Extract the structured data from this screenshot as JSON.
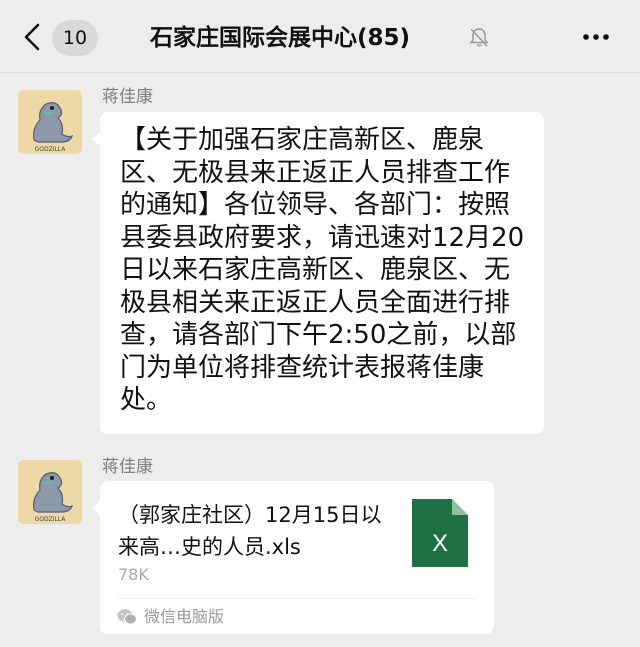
{
  "header": {
    "unread_count": "10",
    "title": "石家庄国际会展中心(85)"
  },
  "messages": [
    {
      "sender": "蒋佳康",
      "avatar_text": "GODZILLA",
      "text": "【关于加强石家庄高新区、鹿泉区、无极县来正返正人员排查工作的通知】各位领导、各部门：按照县委县政府要求，请迅速对12月20日以来石家庄高新区、鹿泉区、无极县相关来正返正人员全面进行排查，请各部门下午2:50之前，以部门为单位将排查统计表报蒋佳康处。"
    },
    {
      "sender": "蒋佳康",
      "avatar_text": "GODZILLA",
      "file": {
        "name": "（郭家庄社区）12月15日以来高…史的人员.xls",
        "size": "78K",
        "icon_letter": "X",
        "source": "微信电脑版"
      }
    }
  ],
  "colors": {
    "background": "#ededed",
    "bubble": "#ffffff",
    "excel": "#1e7145",
    "avatar_bg": "#ecd9a7"
  },
  "icons": [
    "back-chevron-icon",
    "mute-bell-icon",
    "more-icon",
    "excel-file-icon",
    "wechat-icon"
  ]
}
